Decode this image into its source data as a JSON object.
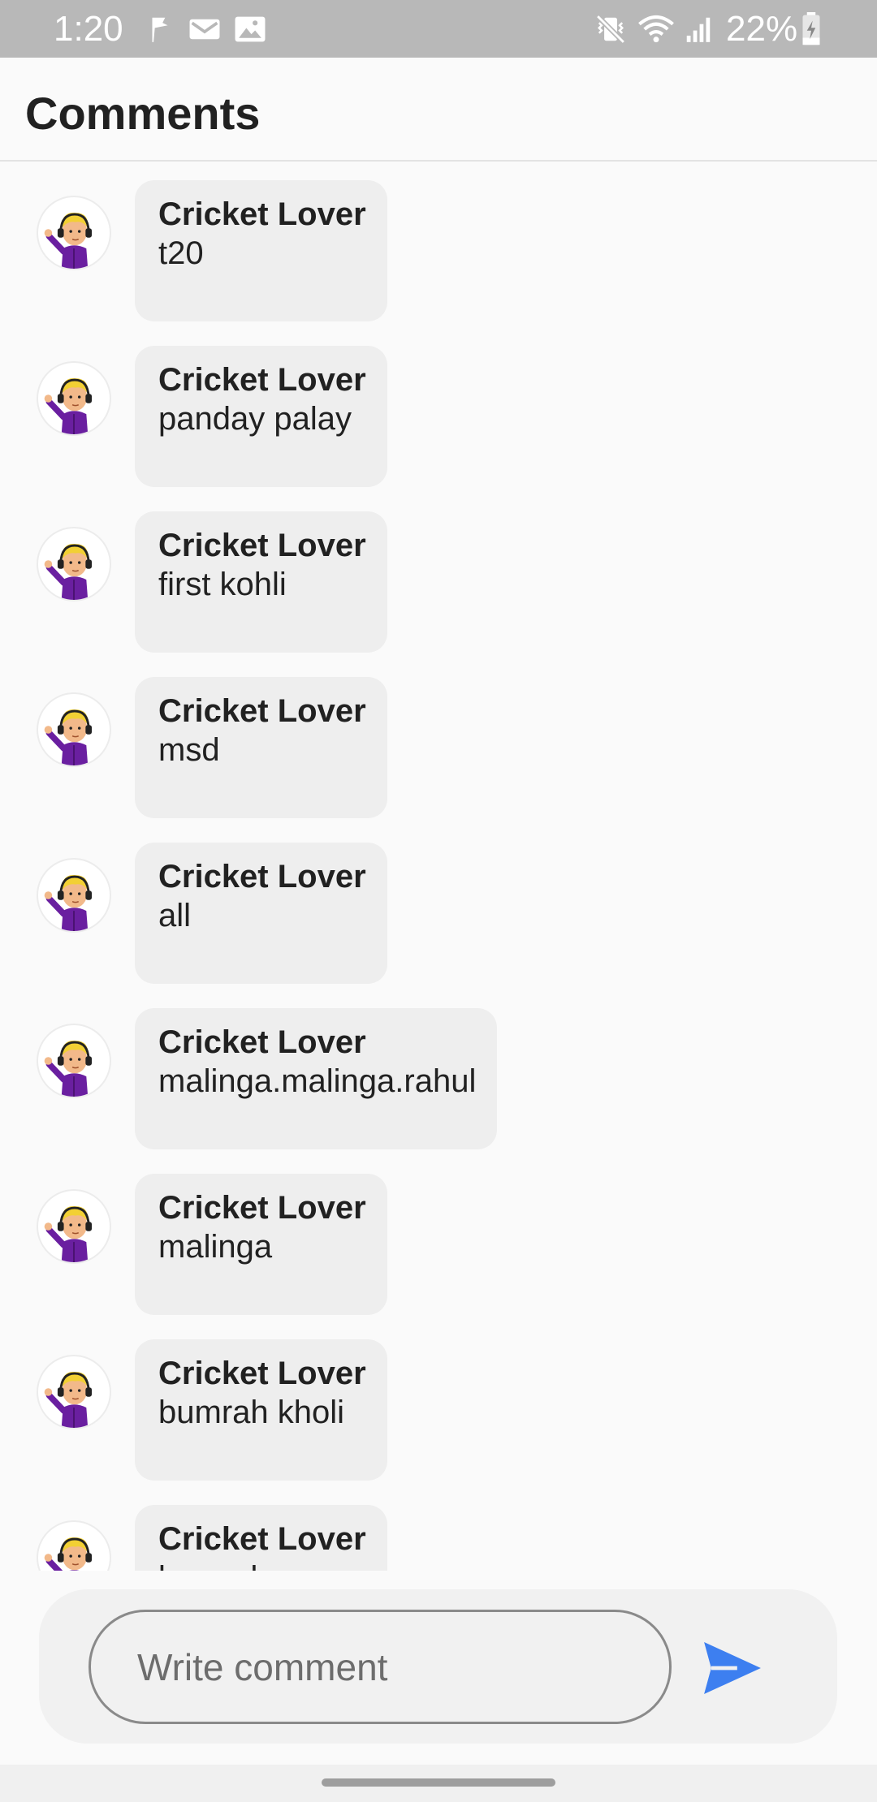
{
  "status_bar": {
    "time": "1:20",
    "battery_percent": "22%",
    "icons": [
      "notification-flag-icon",
      "gmail-icon",
      "gallery-icon",
      "vibrate-mute-icon",
      "wifi-icon",
      "signal-icon",
      "battery-charging-icon"
    ],
    "background": "#b8b8b8"
  },
  "header": {
    "title": "Comments"
  },
  "comments": [
    {
      "author": "Cricket Lover",
      "text": "t20"
    },
    {
      "author": "Cricket Lover",
      "text": "panday palay"
    },
    {
      "author": "Cricket Lover",
      "text": "first kohli"
    },
    {
      "author": "Cricket Lover",
      "text": "msd"
    },
    {
      "author": "Cricket Lover",
      "text": "all"
    },
    {
      "author": "Cricket Lover",
      "text": "malinga.malinga.rahul"
    },
    {
      "author": "Cricket Lover",
      "text": "malinga"
    },
    {
      "author": "Cricket Lover",
      "text": "bumrah kholi"
    },
    {
      "author": "Cricket Lover",
      "text": "bumrah"
    }
  ],
  "composer": {
    "placeholder": "Write comment",
    "value": "",
    "send_icon": "send-icon",
    "accent_color": "#3d7ff0"
  }
}
